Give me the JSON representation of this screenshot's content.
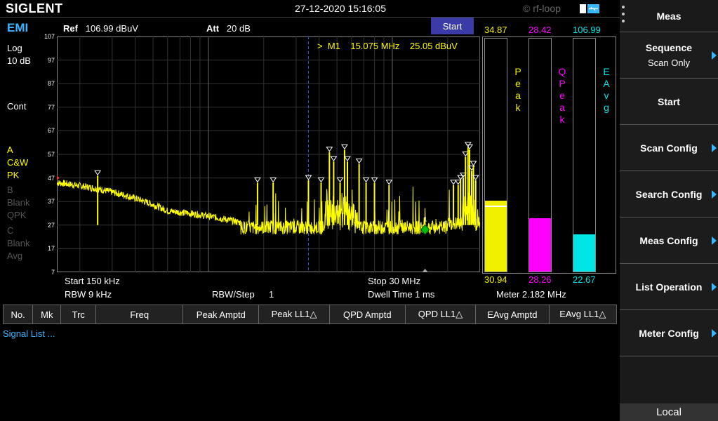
{
  "header": {
    "brand": "SIGLENT",
    "datetime": "27-12-2020 15:16:05",
    "watermark": "© rf-loop"
  },
  "mode": "EMI",
  "ref": {
    "label": "Ref",
    "value": "106.99 dBuV"
  },
  "att": {
    "label": "Att",
    "value": "20 dB"
  },
  "scale": {
    "type": "Log",
    "div": "10 dB"
  },
  "sweep_mode": "Cont",
  "traces": [
    {
      "letter": "A",
      "type": "C&W",
      "det": "PK",
      "color": "#ffff00"
    },
    {
      "letter": "B",
      "type": "Blank",
      "det": "QPK",
      "color": "#555555"
    },
    {
      "letter": "C",
      "type": "Blank",
      "det": "Avg",
      "color": "#555555"
    }
  ],
  "start_button": "Start",
  "marker_readout": {
    "prefix": ">",
    "name": "M1",
    "freq": "15.075 MHz",
    "ampl": "25.05 dBuV"
  },
  "meters": {
    "peak": {
      "label": "Peak",
      "top": "34.87",
      "bottom": "30.94",
      "level": 0.305,
      "color": "#f0f000"
    },
    "qpeak": {
      "label": "QPeak",
      "top": "28.42",
      "bottom": "28.26",
      "level": 0.23,
      "color": "#ff00ff"
    },
    "eavg": {
      "label": "EAvg",
      "top": "106.99",
      "bottom": "22.67",
      "level": 0.16,
      "color": "#00e5e5"
    }
  },
  "meter_freq": "Meter 2.182 MHz",
  "footer": {
    "start": "Start  150 kHz",
    "stop": "Stop  30 MHz",
    "rbw": "RBW  9 kHz",
    "rbw_step_label": "RBW/Step",
    "rbw_step_value": "1",
    "dwell": "Dwell Time   1 ms"
  },
  "table": {
    "columns": [
      "No.",
      "Mk",
      "Trc",
      "Freq",
      "Peak Amptd",
      "Peak LL1△",
      "QPD Amptd",
      "QPD LL1△",
      "EAvg Amptd",
      "EAvg LL1△"
    ]
  },
  "signal_list": "Signal List ...",
  "sidebar": {
    "title": "Meas",
    "items": [
      {
        "label": "Sequence",
        "sub": "Scan Only",
        "arrow": true
      },
      {
        "label": "Start",
        "sub": "",
        "arrow": false
      },
      {
        "label": "Scan Config",
        "sub": "",
        "arrow": true
      },
      {
        "label": "Search Config",
        "sub": "",
        "arrow": true
      },
      {
        "label": "Meas Config",
        "sub": "",
        "arrow": true
      },
      {
        "label": "List Operation",
        "sub": "",
        "arrow": true
      },
      {
        "label": "Meter Config",
        "sub": "",
        "arrow": true
      }
    ],
    "local": "Local"
  },
  "chart_data": {
    "type": "line",
    "xlabel": "",
    "ylabel": "",
    "x_scale": "log",
    "xlim_mhz": [
      0.15,
      30
    ],
    "ylim": [
      7,
      107
    ],
    "y_ticks": [
      107,
      97,
      87,
      77,
      67,
      57,
      47,
      37,
      27,
      17,
      7
    ],
    "marker_x_mhz": 15.075,
    "marker_y": 25.05,
    "peaks": [
      {
        "x_mhz": 0.25,
        "y": 48
      },
      {
        "x_mhz": 1.85,
        "y": 45
      },
      {
        "x_mhz": 2.25,
        "y": 45
      },
      {
        "x_mhz": 3.5,
        "y": 46
      },
      {
        "x_mhz": 4.1,
        "y": 45
      },
      {
        "x_mhz": 4.55,
        "y": 58
      },
      {
        "x_mhz": 4.8,
        "y": 54
      },
      {
        "x_mhz": 5.2,
        "y": 45
      },
      {
        "x_mhz": 5.5,
        "y": 59
      },
      {
        "x_mhz": 5.7,
        "y": 54
      },
      {
        "x_mhz": 6.6,
        "y": 53
      },
      {
        "x_mhz": 7.2,
        "y": 45
      },
      {
        "x_mhz": 8.0,
        "y": 45
      },
      {
        "x_mhz": 9.6,
        "y": 44
      },
      {
        "x_mhz": 21.5,
        "y": 44
      },
      {
        "x_mhz": 22.8,
        "y": 44
      },
      {
        "x_mhz": 23.5,
        "y": 46
      },
      {
        "x_mhz": 24.3,
        "y": 47
      },
      {
        "x_mhz": 25.0,
        "y": 56
      },
      {
        "x_mhz": 25.8,
        "y": 60
      },
      {
        "x_mhz": 26.3,
        "y": 59
      },
      {
        "x_mhz": 27.0,
        "y": 50
      },
      {
        "x_mhz": 27.6,
        "y": 52
      },
      {
        "x_mhz": 28.4,
        "y": 46
      }
    ]
  }
}
